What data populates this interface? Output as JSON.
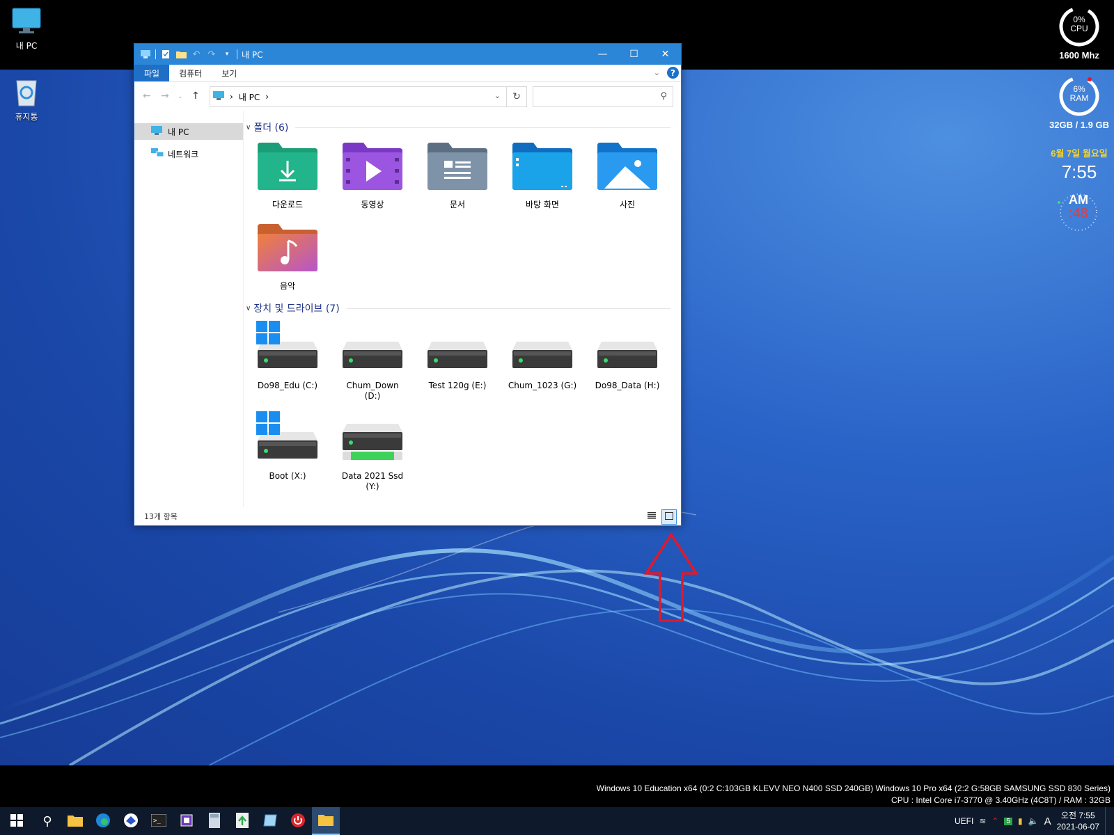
{
  "desktop": {
    "icons": [
      {
        "label": "내 PC",
        "icon": "computer-icon"
      },
      {
        "label": "휴지통",
        "icon": "recycle-bin-icon"
      }
    ]
  },
  "widgets": {
    "cpu": {
      "percent": "0%",
      "label": "CPU",
      "sub": "1600 Mhz"
    },
    "ram": {
      "percent": "6%",
      "label": "RAM",
      "sub": "32GB / 1.9 GB"
    },
    "date": "6월 7일 월요일",
    "time": "7:55",
    "ampm": "AM",
    "seconds": ":48"
  },
  "window": {
    "title": "내 PC",
    "tabs": [
      "파일",
      "컴퓨터",
      "보기"
    ],
    "address": {
      "crumb": "내 PC",
      "separator": "›"
    },
    "search_placeholder": "",
    "sidebar": [
      {
        "label": "내 PC",
        "icon": "computer-icon",
        "selected": true
      },
      {
        "label": "네트워크",
        "icon": "network-icon",
        "selected": false
      }
    ],
    "folders_header": "폴더 (6)",
    "folders": [
      {
        "label": "다운로드",
        "icon": "downloads-folder-icon",
        "color": "#1b9e77"
      },
      {
        "label": "동영상",
        "icon": "videos-folder-icon",
        "color": "#8e44d9"
      },
      {
        "label": "문서",
        "icon": "documents-folder-icon",
        "color": "#6b7f94"
      },
      {
        "label": "바탕 화면",
        "icon": "desktop-folder-icon",
        "color": "#1a8fd8"
      },
      {
        "label": "사진",
        "icon": "pictures-folder-icon",
        "color": "#2088e0"
      },
      {
        "label": "음악",
        "icon": "music-folder-icon",
        "color": "#e0673a"
      }
    ],
    "drives_header": "장치 및 드라이브 (7)",
    "drives": [
      {
        "label": "Do98_Edu (C:)",
        "windows_logo": true,
        "ssd_bar": false
      },
      {
        "label": "Chum_Down (D:)",
        "windows_logo": false,
        "ssd_bar": false
      },
      {
        "label": "Test 120g (E:)",
        "windows_logo": false,
        "ssd_bar": false
      },
      {
        "label": "Chum_1023 (G:)",
        "windows_logo": false,
        "ssd_bar": false
      },
      {
        "label": "Do98_Data (H:)",
        "windows_logo": false,
        "ssd_bar": false
      },
      {
        "label": "Boot (X:)",
        "windows_logo": true,
        "ssd_bar": false
      },
      {
        "label": "Data 2021 Ssd (Y:)",
        "windows_logo": false,
        "ssd_bar": true
      }
    ],
    "status_count": "13개 항목"
  },
  "info": {
    "line1": "Windows 10 Education x64 (0:2 C:103GB KLEVV NEO N400 SSD 240GB) Windows 10 Pro x64 (2:2 G:58GB SAMSUNG SSD 830 Series)",
    "line2": "CPU : Intel Core i7-3770 @ 3.40GHz (4C8T) / RAM : 32GB"
  },
  "taskbar": {
    "tray_text": "UEFI",
    "tray_badge": "5",
    "ime": "A",
    "clock_time": "오전 7:55",
    "clock_date": "2021-06-07"
  },
  "colors": {
    "accent": "#2b86d8",
    "annotation_arrow": "#e0192b"
  }
}
